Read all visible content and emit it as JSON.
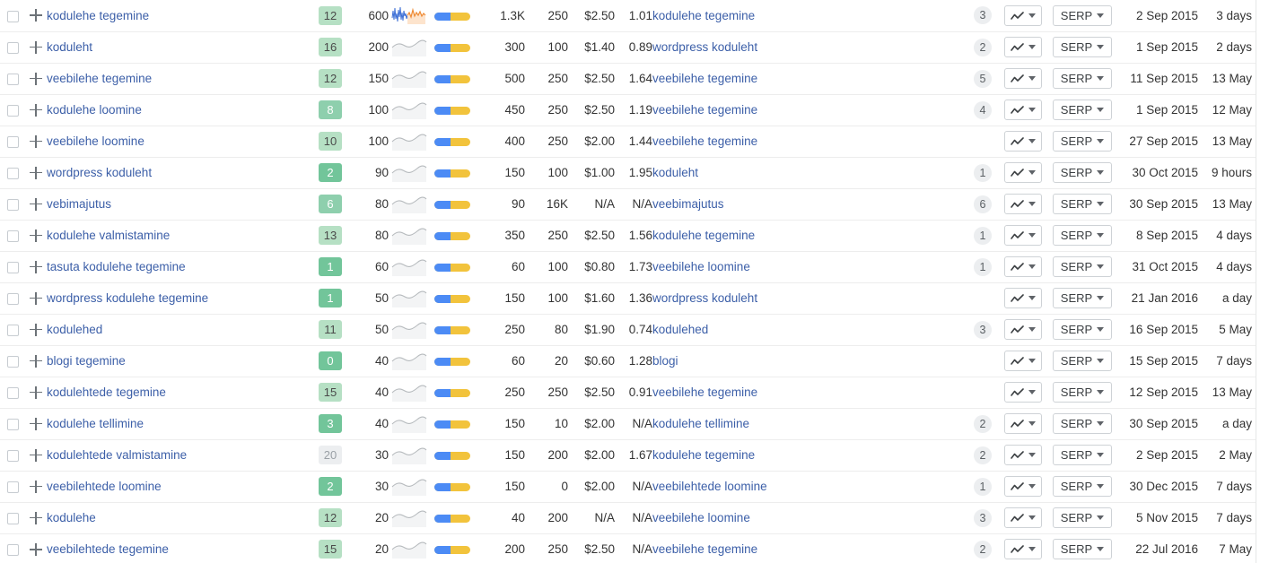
{
  "colors": {
    "link": "#3c5fa8",
    "kd_easy": "#72c59a",
    "kd_medium": "#b6e0c4",
    "kd_none": "#eceef0",
    "bar_blue": "#4c8bf5",
    "bar_yellow": "#f2c33c",
    "na_text": "#b9bcc0",
    "row_border": "#ededed"
  },
  "controls": {
    "chart_button_icon": "line-chart-icon",
    "serp_button_label": "SERP",
    "refresh_icon": "refresh-icon",
    "add_icon": "plus-icon",
    "caret_icon": "caret-down-icon"
  },
  "table": {
    "columns": [
      "select",
      "add",
      "keyword",
      "difficulty",
      "volume",
      "trend",
      "share",
      "clicks",
      "cpc_volume",
      "cpc",
      "ratio",
      "target_keyword",
      "count",
      "chart",
      "serp",
      "date",
      "age",
      "refresh"
    ],
    "rows": [
      {
        "keyword": "kodulehe tegemine",
        "kd": "12",
        "kd_class": "kd-g3",
        "volume": "600",
        "spark": "active",
        "n1": "1.3K",
        "n2": "250",
        "cpc": "$2.50",
        "ratio": "1.01",
        "target": "kodulehe tegemine",
        "count": "3",
        "serp": "SERP",
        "date": "2 Sep 2015",
        "age": "3 days"
      },
      {
        "keyword": "koduleht",
        "kd": "16",
        "kd_class": "kd-g3",
        "volume": "200",
        "spark": "wave",
        "n1": "300",
        "n2": "100",
        "cpc": "$1.40",
        "ratio": "0.89",
        "target": "wordpress koduleht",
        "count": "2",
        "serp": "SERP",
        "date": "1 Sep 2015",
        "age": "2 days"
      },
      {
        "keyword": "veebilehe tegemine",
        "kd": "12",
        "kd_class": "kd-g3",
        "volume": "150",
        "spark": "wave",
        "n1": "500",
        "n2": "250",
        "cpc": "$2.50",
        "ratio": "1.64",
        "target": "veebilehe tegemine",
        "count": "5",
        "serp": "SERP",
        "date": "11 Sep 2015",
        "age": "13 May"
      },
      {
        "keyword": "kodulehe loomine",
        "kd": "8",
        "kd_class": "kd-g2",
        "volume": "100",
        "spark": "wave",
        "n1": "450",
        "n2": "250",
        "cpc": "$2.50",
        "ratio": "1.19",
        "target": "veebilehe tegemine",
        "count": "4",
        "serp": "SERP",
        "date": "1 Sep 2015",
        "age": "12 May"
      },
      {
        "keyword": "veebilehe loomine",
        "kd": "10",
        "kd_class": "kd-g3",
        "volume": "100",
        "spark": "wave",
        "n1": "400",
        "n2": "250",
        "cpc": "$2.00",
        "ratio": "1.44",
        "target": "veebilehe tegemine",
        "count": "",
        "serp": "SERP",
        "date": "27 Sep 2015",
        "age": "13 May"
      },
      {
        "keyword": "wordpress koduleht",
        "kd": "2",
        "kd_class": "kd-g1",
        "volume": "90",
        "spark": "wave",
        "n1": "150",
        "n2": "100",
        "cpc": "$1.00",
        "ratio": "1.95",
        "target": "koduleht",
        "count": "1",
        "serp": "SERP",
        "date": "30 Oct 2015",
        "age": "9 hours"
      },
      {
        "keyword": "vebimajutus",
        "kd": "6",
        "kd_class": "kd-g2",
        "volume": "80",
        "spark": "wave",
        "n1": "90",
        "n2": "16K",
        "cpc": "N/A",
        "ratio": "N/A",
        "target": "veebimajutus",
        "count": "6",
        "serp": "SERP",
        "date": "30 Sep 2015",
        "age": "13 May"
      },
      {
        "keyword": "kodulehe valmistamine",
        "kd": "13",
        "kd_class": "kd-g3",
        "volume": "80",
        "spark": "wave",
        "n1": "350",
        "n2": "250",
        "cpc": "$2.50",
        "ratio": "1.56",
        "target": "kodulehe tegemine",
        "count": "1",
        "serp": "SERP",
        "date": "8 Sep 2015",
        "age": "4 days"
      },
      {
        "keyword": "tasuta kodulehe tegemine",
        "kd": "1",
        "kd_class": "kd-g1",
        "volume": "60",
        "spark": "wave",
        "n1": "60",
        "n2": "100",
        "cpc": "$0.80",
        "ratio": "1.73",
        "target": "veebilehe loomine",
        "count": "1",
        "serp": "SERP",
        "date": "31 Oct 2015",
        "age": "4 days"
      },
      {
        "keyword": "wordpress kodulehe tegemine",
        "kd": "1",
        "kd_class": "kd-g1",
        "volume": "50",
        "spark": "wave",
        "n1": "150",
        "n2": "100",
        "cpc": "$1.60",
        "ratio": "1.36",
        "target": "wordpress koduleht",
        "count": "",
        "serp": "SERP",
        "date": "21 Jan 2016",
        "age": "a day"
      },
      {
        "keyword": "kodulehed",
        "kd": "11",
        "kd_class": "kd-g3",
        "volume": "50",
        "spark": "wave",
        "n1": "250",
        "n2": "80",
        "cpc": "$1.90",
        "ratio": "0.74",
        "target": "kodulehed",
        "count": "3",
        "serp": "SERP",
        "date": "16 Sep 2015",
        "age": "5 May"
      },
      {
        "keyword": "blogi tegemine",
        "kd": "0",
        "kd_class": "kd-g1",
        "volume": "40",
        "spark": "wave",
        "n1": "60",
        "n2": "20",
        "cpc": "$0.60",
        "ratio": "1.28",
        "target": "blogi",
        "count": "",
        "serp": "SERP",
        "date": "15 Sep 2015",
        "age": "7 days"
      },
      {
        "keyword": "kodulehtede tegemine",
        "kd": "15",
        "kd_class": "kd-g3",
        "volume": "40",
        "spark": "wave",
        "n1": "250",
        "n2": "250",
        "cpc": "$2.50",
        "ratio": "0.91",
        "target": "veebilehe tegemine",
        "count": "",
        "serp": "SERP",
        "date": "12 Sep 2015",
        "age": "13 May"
      },
      {
        "keyword": "kodulehe tellimine",
        "kd": "3",
        "kd_class": "kd-g1",
        "volume": "40",
        "spark": "wave",
        "n1": "150",
        "n2": "10",
        "cpc": "$2.00",
        "ratio": "N/A",
        "target": "kodulehe tellimine",
        "count": "2",
        "serp": "SERP",
        "date": "30 Sep 2015",
        "age": "a day"
      },
      {
        "keyword": "kodulehtede valmistamine",
        "kd": "20",
        "kd_class": "kd-g4",
        "volume": "30",
        "spark": "wave",
        "n1": "150",
        "n2": "200",
        "cpc": "$2.00",
        "ratio": "1.67",
        "target": "kodulehe tegemine",
        "count": "2",
        "serp": "SERP",
        "date": "2 Sep 2015",
        "age": "2 May"
      },
      {
        "keyword": "veebilehtede loomine",
        "kd": "2",
        "kd_class": "kd-g1",
        "volume": "30",
        "spark": "wave",
        "n1": "150",
        "n2": "0",
        "cpc": "$2.00",
        "ratio": "N/A",
        "target": "veebilehtede loomine",
        "count": "1",
        "serp": "SERP",
        "date": "30 Dec 2015",
        "age": "7 days"
      },
      {
        "keyword": "kodulehe",
        "kd": "12",
        "kd_class": "kd-g3",
        "volume": "20",
        "spark": "wave",
        "n1": "40",
        "n2": "200",
        "cpc": "N/A",
        "ratio": "N/A",
        "target": "veebilehe loomine",
        "count": "3",
        "serp": "SERP",
        "date": "5 Nov 2015",
        "age": "7 days"
      },
      {
        "keyword": "veebilehtede tegemine",
        "kd": "15",
        "kd_class": "kd-g3",
        "volume": "20",
        "spark": "wave",
        "n1": "200",
        "n2": "250",
        "cpc": "$2.50",
        "ratio": "N/A",
        "target": "veebilehe tegemine",
        "count": "2",
        "serp": "SERP",
        "date": "22 Jul 2016",
        "age": "7 May"
      }
    ]
  }
}
